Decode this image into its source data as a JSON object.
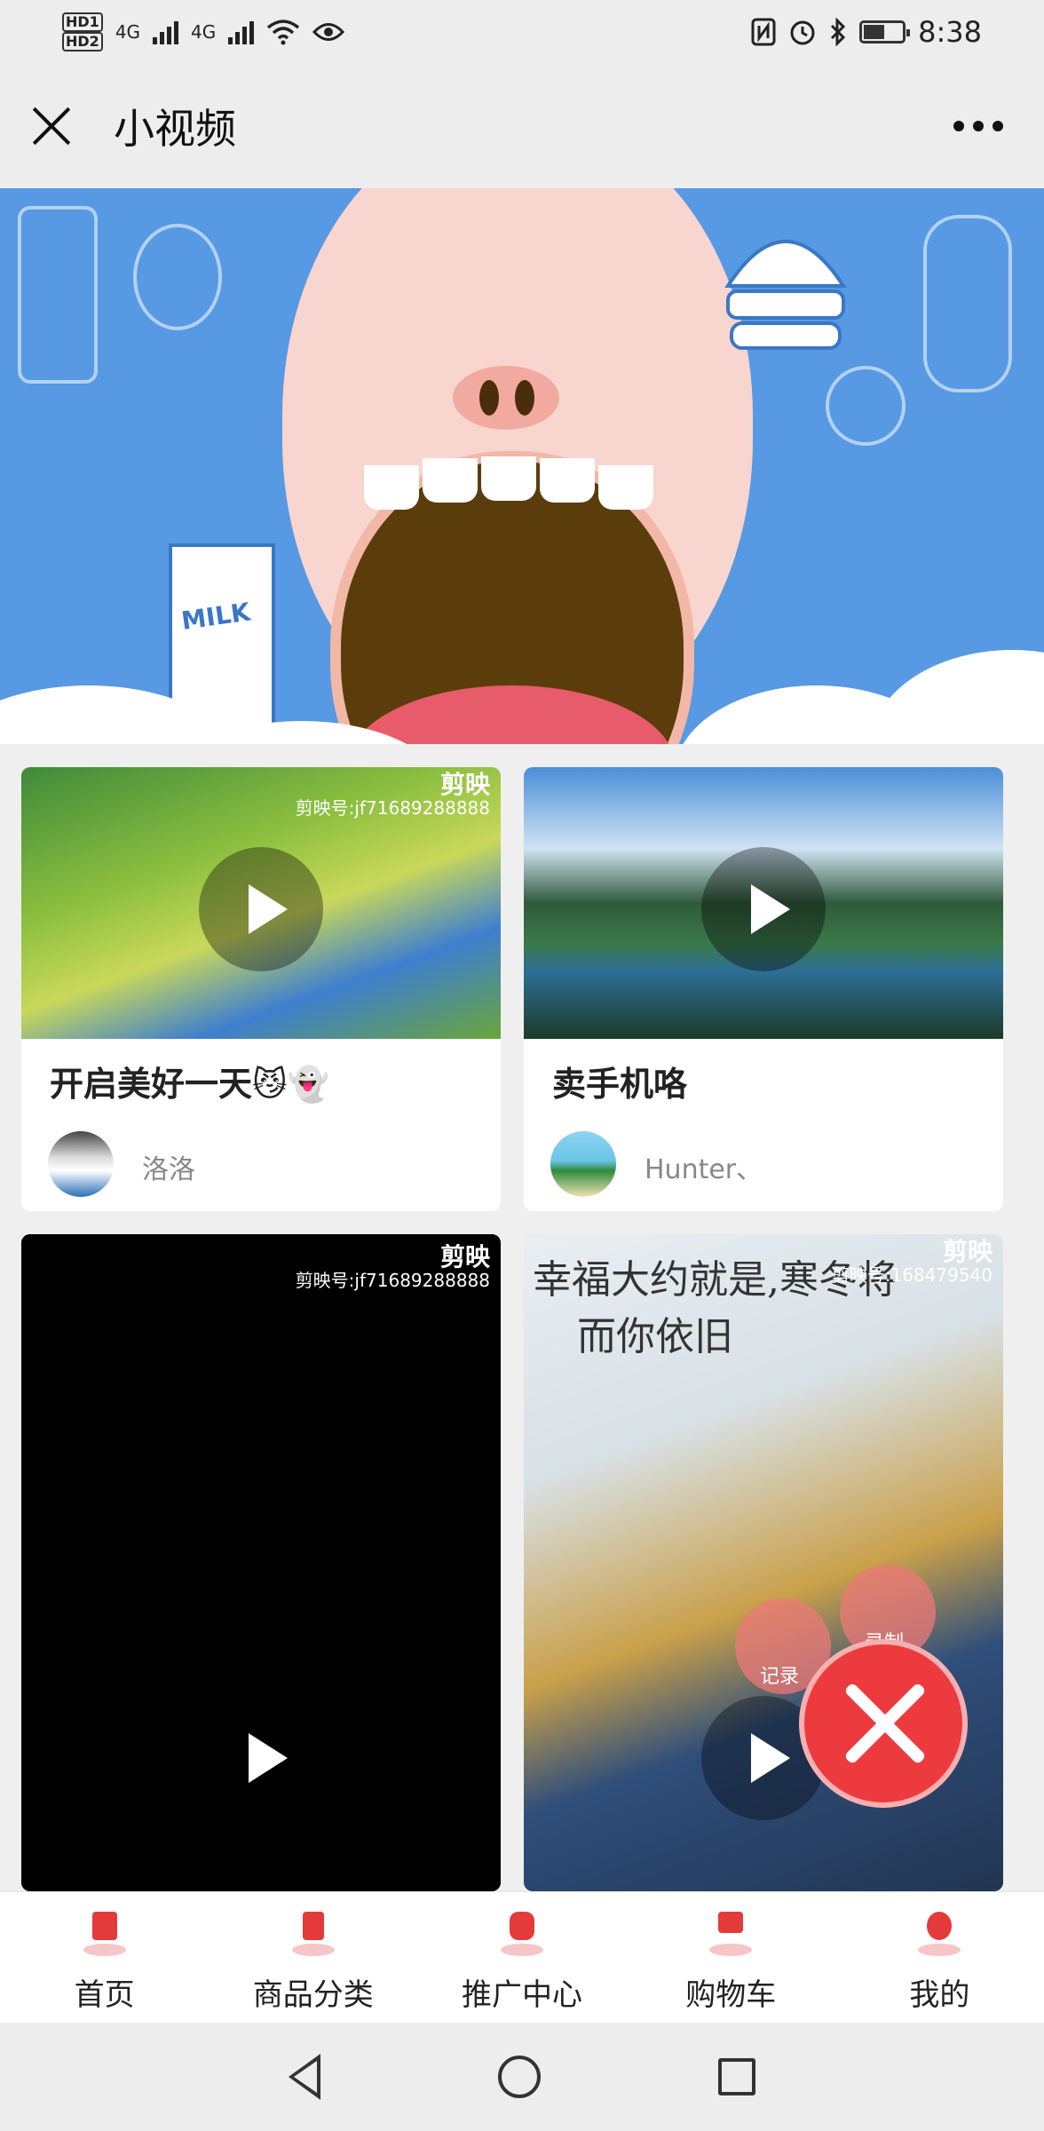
{
  "status_bar": {
    "network_1": "4G",
    "network_2": "4G",
    "hd_1": "HD1",
    "hd_2": "HD2",
    "time": "8:38",
    "battery_level": 0.5,
    "icons": [
      "nfc-icon",
      "alarm-icon",
      "bluetooth-icon",
      "wifi-icon",
      "eye-icon"
    ]
  },
  "header": {
    "title": "小视频"
  },
  "banner": {
    "milk_text": "MILK",
    "active_slide": 1,
    "total_slides": 3
  },
  "videos": [
    {
      "title": "开启美好一天😼👻",
      "author": "洛洛",
      "watermark_brand": "剪映",
      "watermark_id": "剪映号:jf71689288888"
    },
    {
      "title": "卖手机咯",
      "author": "Hunter、"
    },
    {
      "watermark_brand": "剪映",
      "watermark_id": "剪映号:jf71689288888"
    },
    {
      "overlay_text_1": "幸福大约就是,寒冬将",
      "overlay_text_2": "而你依旧",
      "watermark_brand": "剪映",
      "watermark_id": "剪映号:168479540"
    }
  ],
  "float_menu": {
    "record_label": "记录",
    "capture_label": "录制"
  },
  "tabbar": {
    "items": [
      {
        "label": "首页",
        "icon": "bank-icon"
      },
      {
        "label": "商品分类",
        "icon": "chart-icon"
      },
      {
        "label": "推广中心",
        "icon": "coins-icon"
      },
      {
        "label": "购物车",
        "icon": "cart-icon"
      },
      {
        "label": "我的",
        "icon": "user-icon"
      }
    ]
  },
  "colors": {
    "accent": "#e8141c",
    "banner_bg": "#5799e3",
    "fab": "#ec3a3e"
  }
}
